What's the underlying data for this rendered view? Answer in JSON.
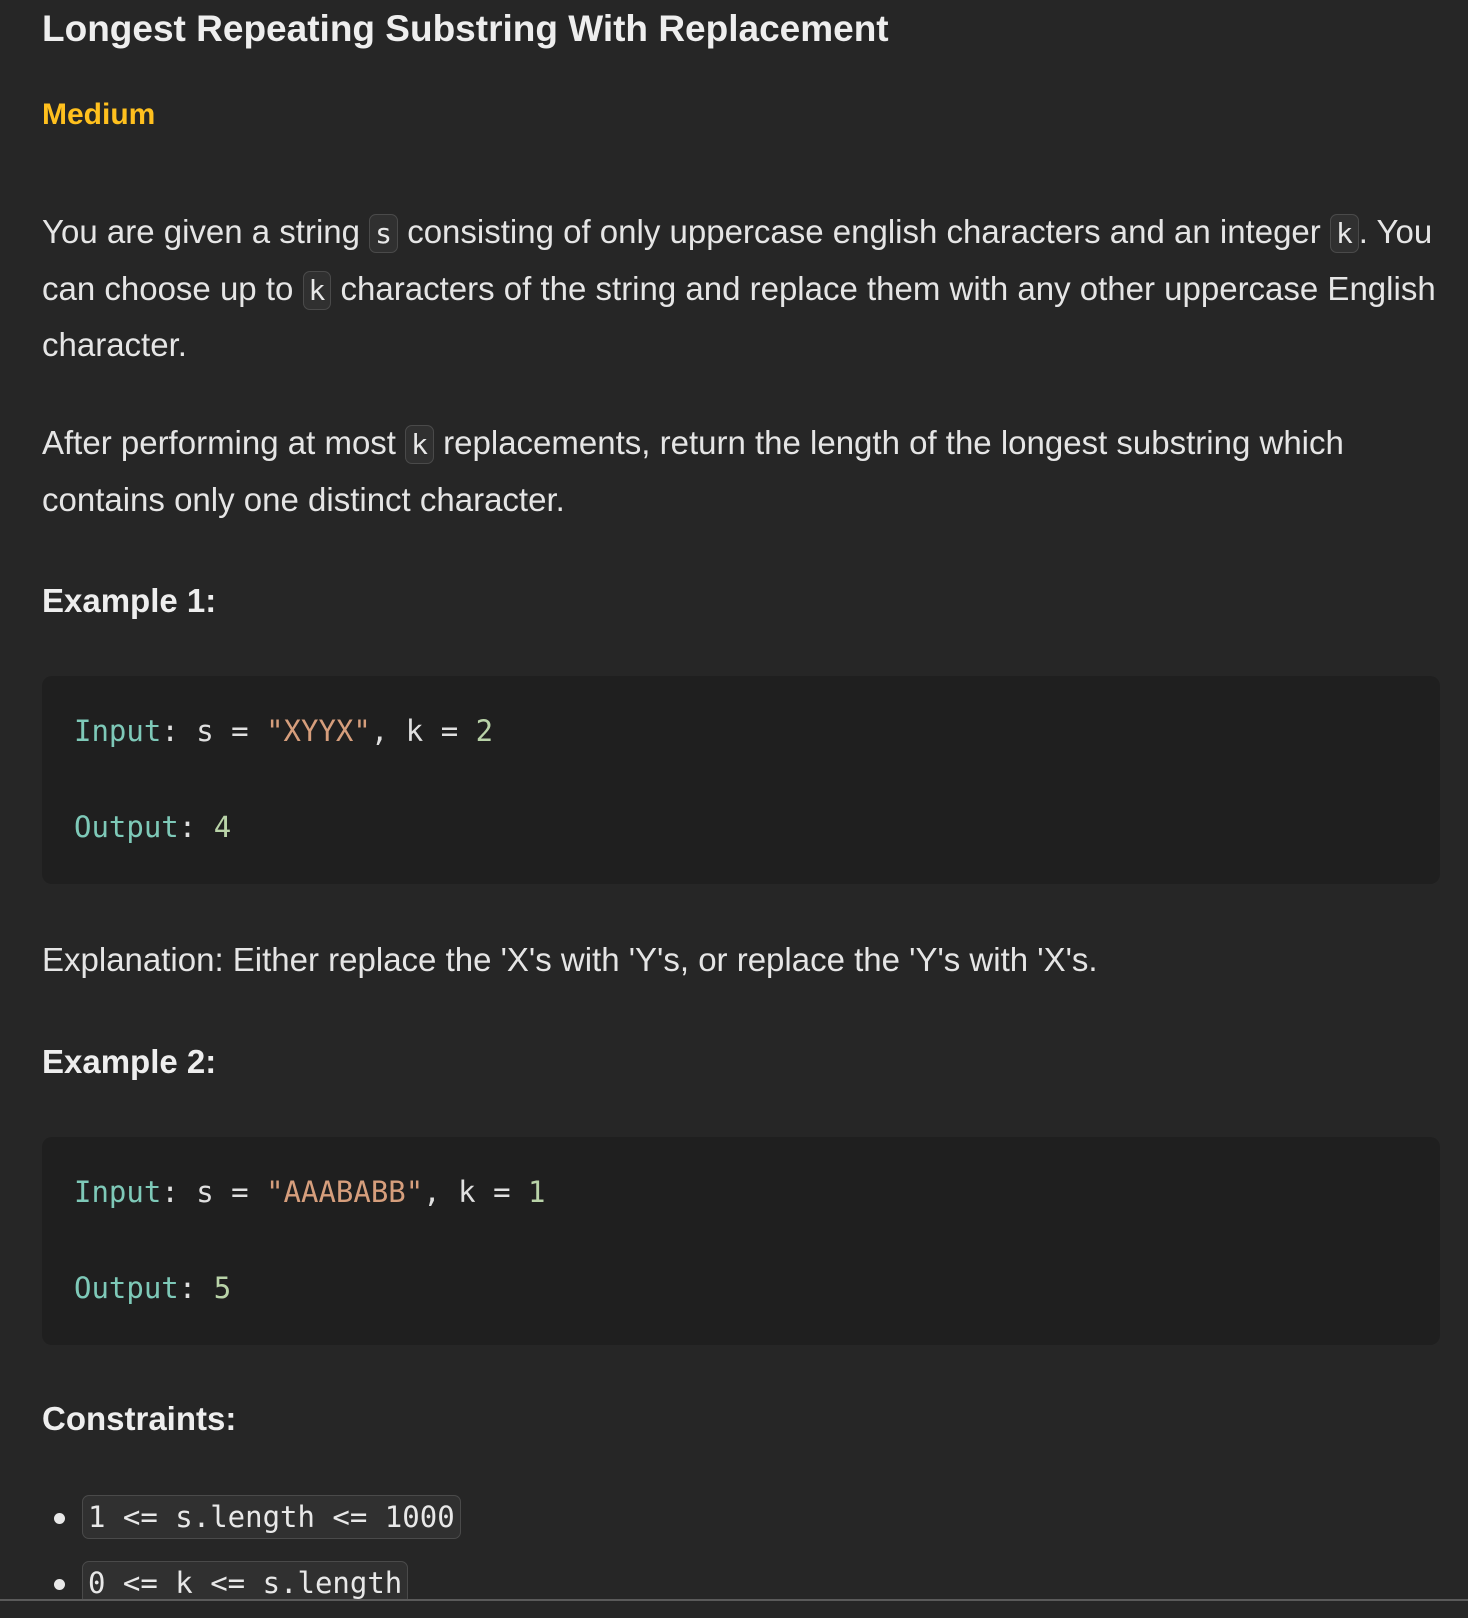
{
  "problem": {
    "title": "Longest Repeating Substring With Replacement",
    "difficulty": "Medium",
    "difficulty_color": "#ffc01e"
  },
  "description": {
    "p1_a": "You are given a string ",
    "p1_code_s": "s",
    "p1_b": " consisting of only uppercase english characters and an integer ",
    "p1_code_k": "k",
    "p1_c": ". You can choose up to ",
    "p1_code_k2": "k",
    "p1_d": " characters of the string and replace them with any other uppercase English character.",
    "p2_a": "After performing at most ",
    "p2_code_k": "k",
    "p2_b": " replacements, return the length of the longest substring which contains only one distinct character."
  },
  "examples": [
    {
      "title": "Example 1:",
      "input_label": "Input",
      "input_var_s": "s",
      "input_s_value": "\"XYYX\"",
      "input_var_k": "k",
      "input_k_value": "2",
      "output_label": "Output",
      "output_value": "4",
      "explanation": "Explanation: Either replace the 'X's with 'Y's, or replace the 'Y's with 'X's."
    },
    {
      "title": "Example 2:",
      "input_label": "Input",
      "input_var_s": "s",
      "input_s_value": "\"AAABABB\"",
      "input_var_k": "k",
      "input_k_value": "1",
      "output_label": "Output",
      "output_value": "5"
    }
  ],
  "constraints": {
    "title": "Constraints:",
    "items": [
      "1 <= s.length <= 1000",
      "0 <= k <= s.length"
    ]
  }
}
